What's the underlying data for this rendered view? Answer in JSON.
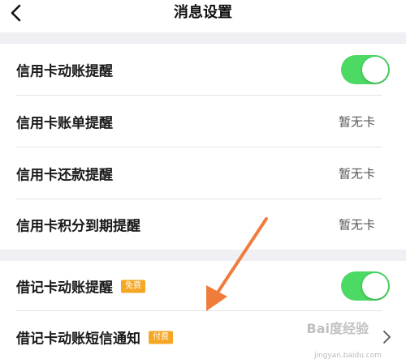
{
  "header": {
    "title": "消息设置",
    "back_icon": "chevron-left-icon"
  },
  "rows": [
    {
      "label": "信用卡动账提醒",
      "control": "toggle",
      "toggle_on": true
    },
    {
      "label": "信用卡账单提醒",
      "value": "暂无卡"
    },
    {
      "label": "信用卡还款提醒",
      "value": "暂无卡"
    },
    {
      "label": "信用卡积分到期提醒",
      "value": "暂无卡"
    },
    {
      "label": "借记卡动账提醒",
      "badge": "免费",
      "control": "toggle",
      "toggle_on": true
    },
    {
      "label": "借记卡动账短信通知",
      "badge": "付费",
      "control": "chevron"
    }
  ],
  "watermark": {
    "text": "Bai度经验",
    "url": "jingyan.baidu.com"
  },
  "colors": {
    "toggle_on": "#4cd964",
    "badge": "#f5a623",
    "section_gap": "#efeff4",
    "annotation_arrow": "#f07c3c"
  }
}
